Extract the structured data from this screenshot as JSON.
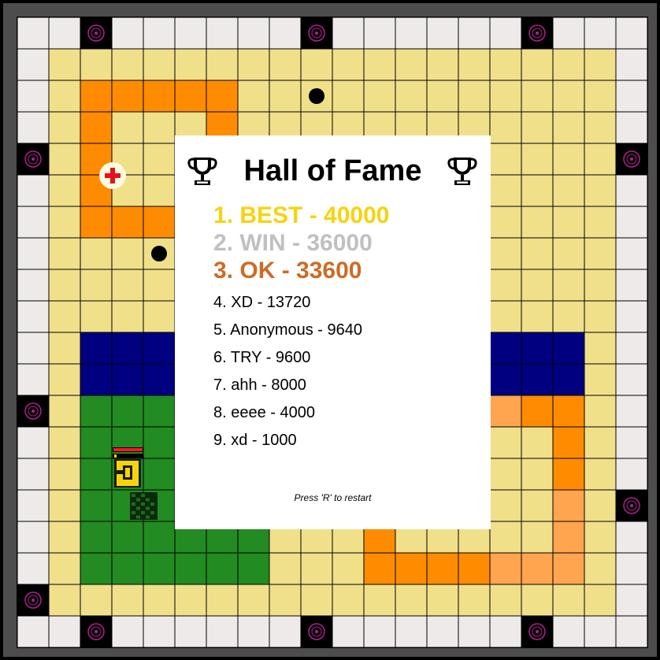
{
  "colors": {
    "frame": "#4d4d4d",
    "outer_cell": "#eeeaea",
    "sand": "#f0e08a",
    "orange": "#ff8c00",
    "light_orange": "#ffa44f",
    "navy": "#000080",
    "green": "#228b22",
    "gold": "#f5d40f",
    "silver": "#c0c0c0",
    "bronze": "#cd6b25",
    "spawner_ring": "#b0208f",
    "medkit_red": "#e8101a"
  },
  "scoreboard": {
    "title": "Hall of Fame",
    "entries": [
      {
        "rank": 1,
        "text": "1. BEST - 40000",
        "color": "#f5d40f"
      },
      {
        "rank": 2,
        "text": "2. WIN - 36000",
        "color": "#c0c0c0"
      },
      {
        "rank": 3,
        "text": "3. OK - 33600",
        "color": "#cd6b25"
      },
      {
        "rank": 4,
        "text": "4. XD - 13720"
      },
      {
        "rank": 5,
        "text": "5. Anonymous - 9640"
      },
      {
        "rank": 6,
        "text": "6. TRY - 9600"
      },
      {
        "rank": 7,
        "text": "7. ahh - 8000"
      },
      {
        "rank": 8,
        "text": "8. eeee - 4000"
      },
      {
        "rank": 9,
        "text": "9. xd - 1000"
      }
    ],
    "restart_hint": "Press 'R' to restart"
  },
  "icons": [
    "trophy-icon",
    "medkit-icon",
    "enemy-spawner-icon",
    "mine-icon",
    "player-tank-icon",
    "enemy-tank-icon",
    "health-bar"
  ]
}
